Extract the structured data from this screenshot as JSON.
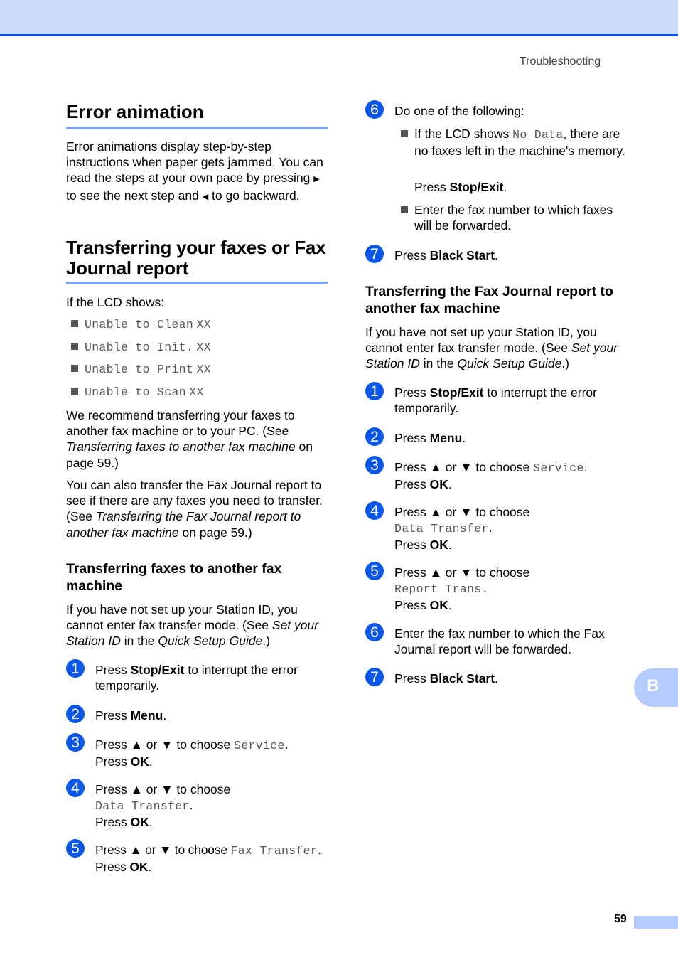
{
  "header": {
    "running_head": "Troubleshooting"
  },
  "error_animation": {
    "title": "Error animation",
    "body_1": "Error animations display step-by-step instructions when paper gets jammed. You can read the steps at your own pace by pressing",
    "right_arrow": "▶",
    "body_2": "to see the next step and",
    "left_arrow": "◀",
    "body_3": "to go backward."
  },
  "transferring": {
    "title_line1": "Transferring your faxes or Fax",
    "title_line2": "Journal report",
    "lcd_intro": "If the LCD shows:",
    "lcd_messages": [
      {
        "text": "Unable to Clean",
        "code": "XX"
      },
      {
        "text": "Unable to Init.",
        "code": "XX"
      },
      {
        "text": "Unable to Print",
        "code": "XX"
      },
      {
        "text": "Unable to Scan",
        "code": "XX"
      }
    ],
    "recommend_1": "We recommend transferring your faxes to another fax machine or to your PC. (See",
    "recommend_link": "Transferring faxes to another fax machine",
    "recommend_2": "on page 59.)",
    "also_1": "You can also transfer the Fax Journal report to see if there are any faxes you need to transfer. (See",
    "also_link": "Transferring the Fax Journal report to another fax machine",
    "also_2": "on page 59.)"
  },
  "faxes_section": {
    "title_line1": "Transferring faxes to another fax",
    "title_line2": "machine",
    "intro_1": "If you have not set up your Station ID, you cannot enter fax transfer mode. (See",
    "intro_link1": "Set your Station ID",
    "intro_2": "in the",
    "intro_link2": "Quick Setup Guide",
    "intro_3": ".)",
    "steps": [
      {
        "num": "1",
        "pre": "Press",
        "bold": "Stop/Exit",
        "post": "to interrupt the error temporarily."
      },
      {
        "num": "2",
        "pre": "Press",
        "bold": "Menu",
        "post": "."
      },
      {
        "num": "3",
        "pre": "Press ▲ or ▼ to choose",
        "mono": "Service",
        "post": ".",
        "line2_pre": "Press",
        "line2_bold": "OK",
        "line2_post": "."
      },
      {
        "num": "4",
        "pre": "Press ▲ or ▼ to choose",
        "mono": "Data Transfer",
        "post": ".",
        "line2_pre": "Press",
        "line2_bold": "OK",
        "line2_post": "."
      },
      {
        "num": "5",
        "pre": "Press ▲ or ▼ to choose",
        "mono": "Fax Transfer",
        "post": ".",
        "line2_pre": "Press",
        "line2_bold": "OK",
        "line2_post": "."
      },
      {
        "num": "6",
        "text": "Do one of the following:",
        "options": [
          {
            "pre": "If the LCD shows",
            "mono": "No Data",
            "post": ", there are no faxes left in the machine's memory.",
            "then_pre": "Press",
            "then_bold": "Stop/Exit",
            "then_post": "."
          },
          {
            "text": "Enter the fax number to which faxes will be forwarded."
          }
        ]
      },
      {
        "num": "7",
        "pre": "Press",
        "bold": "Black Start",
        "post": "."
      }
    ]
  },
  "journal_section": {
    "title_line1": "Transferring the Fax Journal report to",
    "title_line2": "another fax machine",
    "intro_1": "If you have not set up your Station ID, you cannot enter fax transfer mode. (See",
    "intro_link1": "Set your Station ID",
    "intro_2": "in the",
    "intro_link2": "Quick Setup Guide",
    "intro_3": ".)",
    "steps": [
      {
        "num": "1",
        "pre": "Press",
        "bold": "Stop/Exit",
        "post": "to interrupt the error temporarily."
      },
      {
        "num": "2",
        "pre": "Press",
        "bold": "Menu",
        "post": "."
      },
      {
        "num": "3",
        "pre": "Press ▲ or ▼ to choose",
        "mono": "Service",
        "post": ".",
        "line2_pre": "Press",
        "line2_bold": "OK",
        "line2_post": "."
      },
      {
        "num": "4",
        "pre": "Press ▲ or ▼ to choose",
        "mono": "Data Transfer",
        "post": ".",
        "line2_pre": "Press",
        "line2_bold": "OK",
        "line2_post": "."
      },
      {
        "num": "5",
        "pre": "Press ▲ or ▼ to choose",
        "mono": "Report Trans.",
        "post": "",
        "line2_pre": "Press",
        "line2_bold": "OK",
        "line2_post": "."
      },
      {
        "num": "6",
        "text": "Enter the fax number to which the Fax Journal report will be forwarded."
      },
      {
        "num": "7",
        "pre": "Press",
        "bold": "Black Start",
        "post": "."
      }
    ]
  },
  "side_tab": {
    "label": "B"
  },
  "footer": {
    "page_number": "59"
  },
  "colors": {
    "accent": "#0a56e8",
    "header_band": "#cddcfd",
    "rule": "#7ba1f2",
    "tab": "#b4cbfb"
  }
}
